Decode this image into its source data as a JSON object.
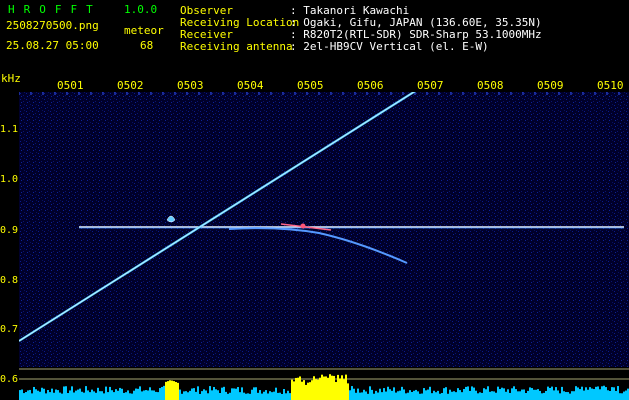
{
  "header": {
    "title": "HROFFT",
    "version": "1.0.0",
    "filename": "2508270500.png",
    "datetime": "25.08.27 05:00",
    "meteor_label": "meteor",
    "meteor_count": "68"
  },
  "info": {
    "observer_label": "Observer",
    "observer_value": ": Takanori Kawachi",
    "location_label": "Receiving Location",
    "location_value": ": Ogaki, Gifu, JAPAN (136.60E, 35.35N)",
    "receiver_label": "Receiver",
    "receiver_value": ": R820T2(RTL-SDR) SDR-Sharp 53.1000MHz",
    "antenna_label": "Receiving antenna",
    "antenna_value": ": 2el-HB9CV Vertical (el. E-W)"
  },
  "axes": {
    "y_unit": "kHz",
    "y_ticks": [
      "1.1",
      "1.0",
      "0.9",
      "0.8",
      "0.7",
      "0.6"
    ],
    "x_ticks": [
      "0501",
      "0502",
      "0503",
      "0504",
      "0505",
      "0506",
      "0507",
      "0508",
      "0509",
      "0510"
    ]
  },
  "colors": {
    "background": "#00002a",
    "label_green": "#00ff00",
    "label_yellow": "#ffff00",
    "trace": "#66ccff",
    "carrier": "#e8f4ff",
    "spectrum_fill": "#00c8ff",
    "spectrum_peak": "#ffff00"
  }
}
